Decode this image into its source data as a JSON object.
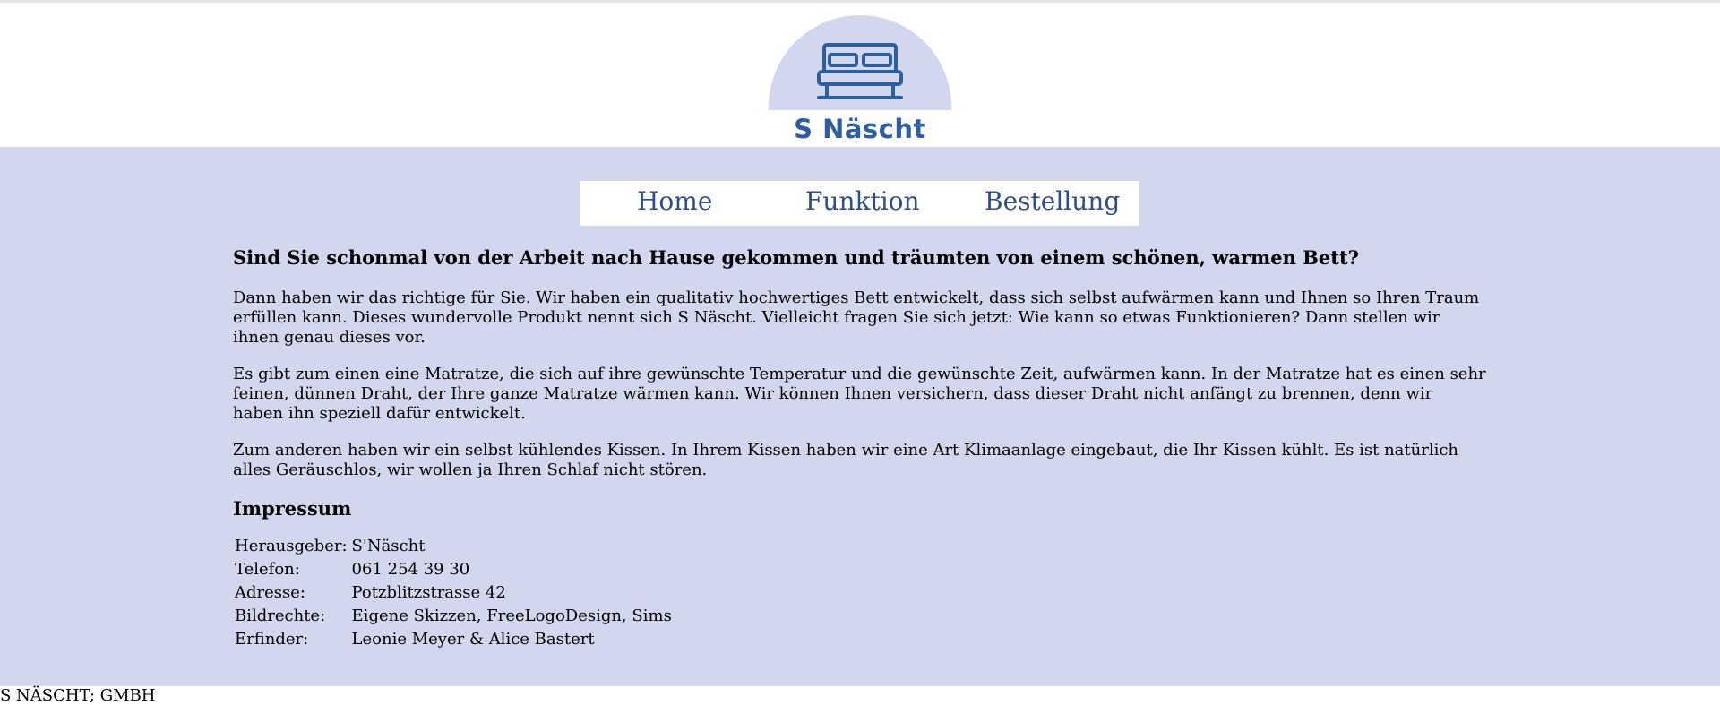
{
  "brand": {
    "name": "S Näscht",
    "logo_icon": "bed-icon",
    "accent": "#2b5fa0",
    "background": "#d3d7ee"
  },
  "nav": {
    "items": [
      {
        "label": "Home"
      },
      {
        "label": "Funktion"
      },
      {
        "label": "Bestellung"
      }
    ]
  },
  "main": {
    "heading": "Sind Sie schonmal von der Arbeit nach Hause gekommen und träumten von einem schönen, warmen Bett?",
    "paragraphs": [
      "Dann haben wir das richtige für Sie. Wir haben ein qualitativ hochwertiges Bett entwickelt, dass sich selbst aufwärmen kann und Ihnen so Ihren Traum erfüllen kann. Dieses wundervolle Produkt nennt sich S Näscht. Vielleicht fragen Sie sich jetzt: Wie kann so etwas Funktionieren? Dann stellen wir ihnen genau dieses vor.",
      "Es gibt zum einen eine Matratze, die sich auf ihre gewünschte Temperatur und die gewünschte Zeit, aufwärmen kann. In der Matratze hat es einen sehr feinen, dünnen Draht, der Ihre ganze Matratze wärmen kann. Wir können Ihnen versichern, dass dieser Draht nicht anfängt zu brennen, denn wir haben ihn speziell dafür entwickelt.",
      "Zum anderen haben wir ein selbst kühlendes Kissen. In Ihrem Kissen haben wir eine Art Klimaanlage eingebaut, die Ihr Kissen kühlt. Es ist natürlich alles Geräuschlos, wir wollen ja Ihren Schlaf nicht stören."
    ],
    "impressum_title": "Impressum",
    "impressum": [
      {
        "label": "Herausgeber:",
        "value": "S'Näscht"
      },
      {
        "label": "Telefon:",
        "value": "061 254 39 30"
      },
      {
        "label": "Adresse:",
        "value": "Potzblitzstrasse 42"
      },
      {
        "label": "Bildrechte:",
        "value": "Eigene Skizzen, FreeLogoDesign, Sims"
      },
      {
        "label": "Erfinder:",
        "value": "Leonie Meyer & Alice Bastert"
      }
    ]
  },
  "footer": {
    "text": "S NÄSCHT; GMBH"
  }
}
